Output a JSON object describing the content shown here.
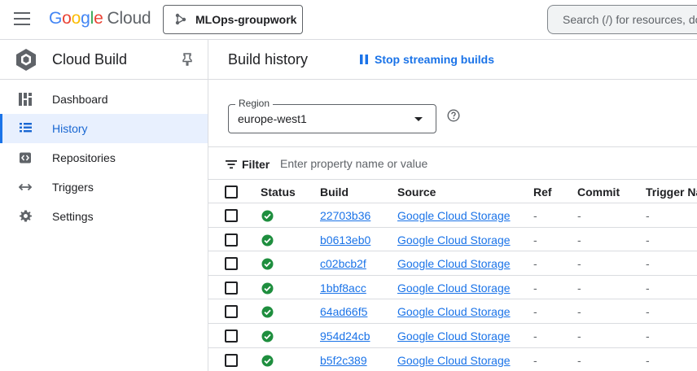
{
  "topbar": {
    "logo_letters": [
      "G",
      "o",
      "o",
      "g",
      "l",
      "e"
    ],
    "logo_suffix": "Cloud",
    "project_name": "MLOps-groupwork",
    "search_placeholder": "Search (/) for resources, do"
  },
  "sidebar": {
    "product_title": "Cloud Build",
    "items": [
      {
        "label": "Dashboard",
        "icon": "dashboard-icon"
      },
      {
        "label": "History",
        "icon": "list-icon",
        "active": true
      },
      {
        "label": "Repositories",
        "icon": "repository-icon"
      },
      {
        "label": "Triggers",
        "icon": "trigger-icon"
      },
      {
        "label": "Settings",
        "icon": "gear-icon"
      }
    ]
  },
  "main": {
    "title": "Build history",
    "stream_button_label": "Stop streaming builds",
    "region": {
      "label": "Region",
      "value": "europe-west1"
    },
    "filter": {
      "label": "Filter",
      "placeholder": "Enter property name or value"
    },
    "table": {
      "headers": {
        "status": "Status",
        "build": "Build",
        "source": "Source",
        "ref": "Ref",
        "commit": "Commit",
        "trigger": "Trigger Na"
      },
      "rows": [
        {
          "build": "22703b36",
          "source": "Google Cloud Storage",
          "ref": "-",
          "commit": "-",
          "trigger": "-"
        },
        {
          "build": "b0613eb0",
          "source": "Google Cloud Storage",
          "ref": "-",
          "commit": "-",
          "trigger": "-"
        },
        {
          "build": "c02bcb2f",
          "source": "Google Cloud Storage",
          "ref": "-",
          "commit": "-",
          "trigger": "-"
        },
        {
          "build": "1bbf8acc",
          "source": "Google Cloud Storage",
          "ref": "-",
          "commit": "-",
          "trigger": "-"
        },
        {
          "build": "64ad66f5",
          "source": "Google Cloud Storage",
          "ref": "-",
          "commit": "-",
          "trigger": "-"
        },
        {
          "build": "954d24cb",
          "source": "Google Cloud Storage",
          "ref": "-",
          "commit": "-",
          "trigger": "-"
        },
        {
          "build": "b5f2c389",
          "source": "Google Cloud Storage",
          "ref": "-",
          "commit": "-",
          "trigger": "-"
        }
      ]
    }
  },
  "colors": {
    "accent": "#1a73e8",
    "success": "#1e8e3e",
    "active_bg": "#e8f0fe"
  }
}
